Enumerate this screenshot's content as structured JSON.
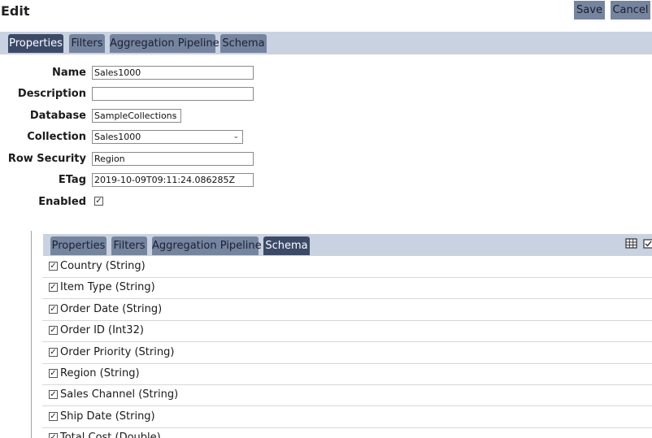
{
  "header": {
    "title": "Edit",
    "save_label": "Save",
    "cancel_label": "Cancel"
  },
  "top_tabs": [
    {
      "label": "Properties",
      "active": true
    },
    {
      "label": "Filters",
      "active": false
    },
    {
      "label": "Aggregation Pipeline",
      "active": false
    },
    {
      "label": "Schema",
      "active": false
    }
  ],
  "form": {
    "name_label": "Name",
    "name_value": "Sales1000",
    "description_label": "Description",
    "description_value": "",
    "database_label": "Database",
    "database_value": "SampleCollections",
    "collection_label": "Collection",
    "collection_value": "Sales1000",
    "row_security_label": "Row Security",
    "row_security_value": "Region",
    "etag_label": "ETag",
    "etag_value": "2019-10-09T09:11:24.086285Z",
    "enabled_label": "Enabled",
    "enabled_checked": true
  },
  "inner_tabs": [
    {
      "label": "Properties",
      "active": false
    },
    {
      "label": "Filters",
      "active": false
    },
    {
      "label": "Aggregation Pipeline",
      "active": false
    },
    {
      "label": "Schema",
      "active": true
    }
  ],
  "schema_fields": [
    {
      "label": "Country (String)",
      "checked": true
    },
    {
      "label": "Item Type (String)",
      "checked": true
    },
    {
      "label": "Order Date (String)",
      "checked": true
    },
    {
      "label": "Order ID (Int32)",
      "checked": true
    },
    {
      "label": "Order Priority (String)",
      "checked": true
    },
    {
      "label": "Region (String)",
      "checked": true
    },
    {
      "label": "Sales Channel (String)",
      "checked": true
    },
    {
      "label": "Ship Date (String)",
      "checked": true
    },
    {
      "label": "Total Cost (Double)",
      "checked": true
    }
  ],
  "icons": {
    "grid": "table-grid-icon",
    "check": "checkbox-icon"
  },
  "colors": {
    "tab": "#7585a0",
    "tab_active": "#3b4a68",
    "tabbar": "#c9d2e0"
  }
}
